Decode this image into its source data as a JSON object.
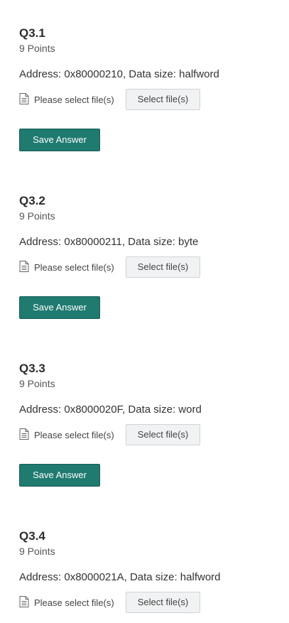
{
  "questions": [
    {
      "title": "Q3.1",
      "points": "9 Points",
      "prompt": "Address: 0x80000210, Data size: halfword",
      "file_label": "Please select file(s)",
      "select_label": "Select file(s)",
      "save_label": "Save Answer"
    },
    {
      "title": "Q3.2",
      "points": "9 Points",
      "prompt": "Address: 0x80000211, Data size: byte",
      "file_label": "Please select file(s)",
      "select_label": "Select file(s)",
      "save_label": "Save Answer"
    },
    {
      "title": "Q3.3",
      "points": "9 Points",
      "prompt": "Address: 0x8000020F, Data size: word",
      "file_label": "Please select file(s)",
      "select_label": "Select file(s)",
      "save_label": "Save Answer"
    },
    {
      "title": "Q3.4",
      "points": "9 Points",
      "prompt": "Address: 0x8000021A, Data size: halfword",
      "file_label": "Please select file(s)",
      "select_label": "Select file(s)"
    }
  ],
  "colors": {
    "save_button_bg": "#1f7a70",
    "select_button_bg": "#f1f2f3"
  }
}
